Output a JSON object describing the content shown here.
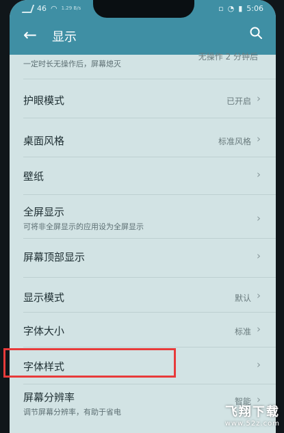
{
  "status_bar": {
    "signal_text": "46",
    "speed": "1.29 B/s",
    "time": "5:06"
  },
  "header": {
    "back_icon": "back-arrow-icon",
    "title": "显示",
    "search_icon": "search-icon"
  },
  "settings": {
    "partial_top": {
      "sub": "一定时长无操作后，屏幕熄灭",
      "value": "无操作 2 分钟后"
    },
    "items": [
      {
        "label": "护眼模式",
        "value": "已开启"
      },
      {
        "label": "桌面风格",
        "value": "标准风格"
      },
      {
        "label": "壁纸",
        "value": ""
      },
      {
        "label": "全屏显示",
        "sub": "可将非全屏显示的应用设为全屏显示",
        "value": ""
      },
      {
        "label": "屏幕顶部显示",
        "value": ""
      },
      {
        "label": "显示模式",
        "value": "默认"
      },
      {
        "label": "字体大小",
        "value": "标准"
      },
      {
        "label": "字体样式",
        "value": ""
      },
      {
        "label": "屏幕分辨率",
        "sub": "调节屏幕分辨率，有助于省电",
        "value": "智能"
      }
    ],
    "chevron": "›"
  },
  "watermark": {
    "main": "飞翔下载",
    "url": "www.52z.com"
  },
  "colors": {
    "accent": "#3f8fa4",
    "highlight": "#e83a3a",
    "background": "#d2e3e4"
  }
}
